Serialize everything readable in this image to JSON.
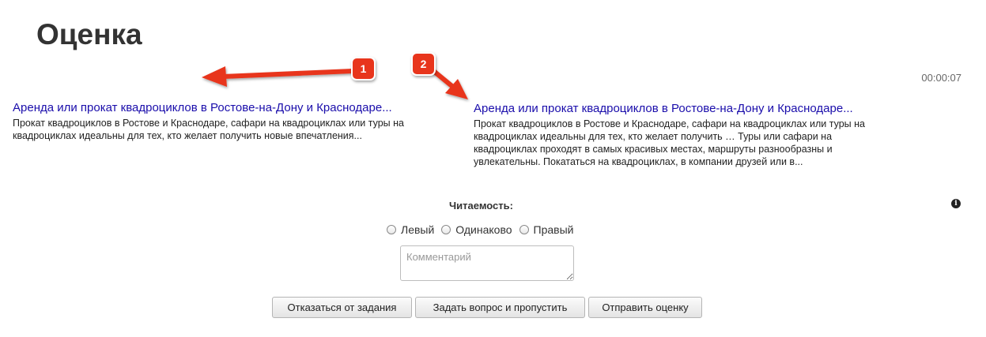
{
  "page": {
    "title": "Оценка",
    "timer": "00:00:07"
  },
  "snippets": {
    "left": {
      "title": "Аренда или прокат квадроциклов в Ростове-на-Дону и Краснодаре...",
      "text": "Прокат квадроциклов в Ростове и Краснодаре, сафари на квадроциклах или туры на квадроциклах идеальны для тех, кто желает получить новые впечатления..."
    },
    "right": {
      "title": "Аренда или прокат квадроциклов в Ростове-на-Дону и Краснодаре...",
      "text": "Прокат квадроциклов в Ростове и Краснодаре, сафари на квадроциклах или туры на квадроциклах идеальны для тех, кто желает получить … Туры или сафари на квадроциклах проходят в самых красивых местах, маршруты разнообразны и увлекательны. Покататься на квадроциклах, в компании друзей или в..."
    }
  },
  "rating": {
    "label": "Читаемость:",
    "options": [
      "Левый",
      "Одинаково",
      "Правый"
    ]
  },
  "comment": {
    "placeholder": "Комментарий",
    "value": ""
  },
  "buttons": {
    "reject": "Отказаться от задания",
    "ask_skip": "Задать вопрос и пропустить",
    "send": "Отправить оценку"
  },
  "annotations": {
    "badge_1": "1",
    "badge_2": "2",
    "color": "#e8341c"
  },
  "icons": {
    "info": "info-icon"
  }
}
